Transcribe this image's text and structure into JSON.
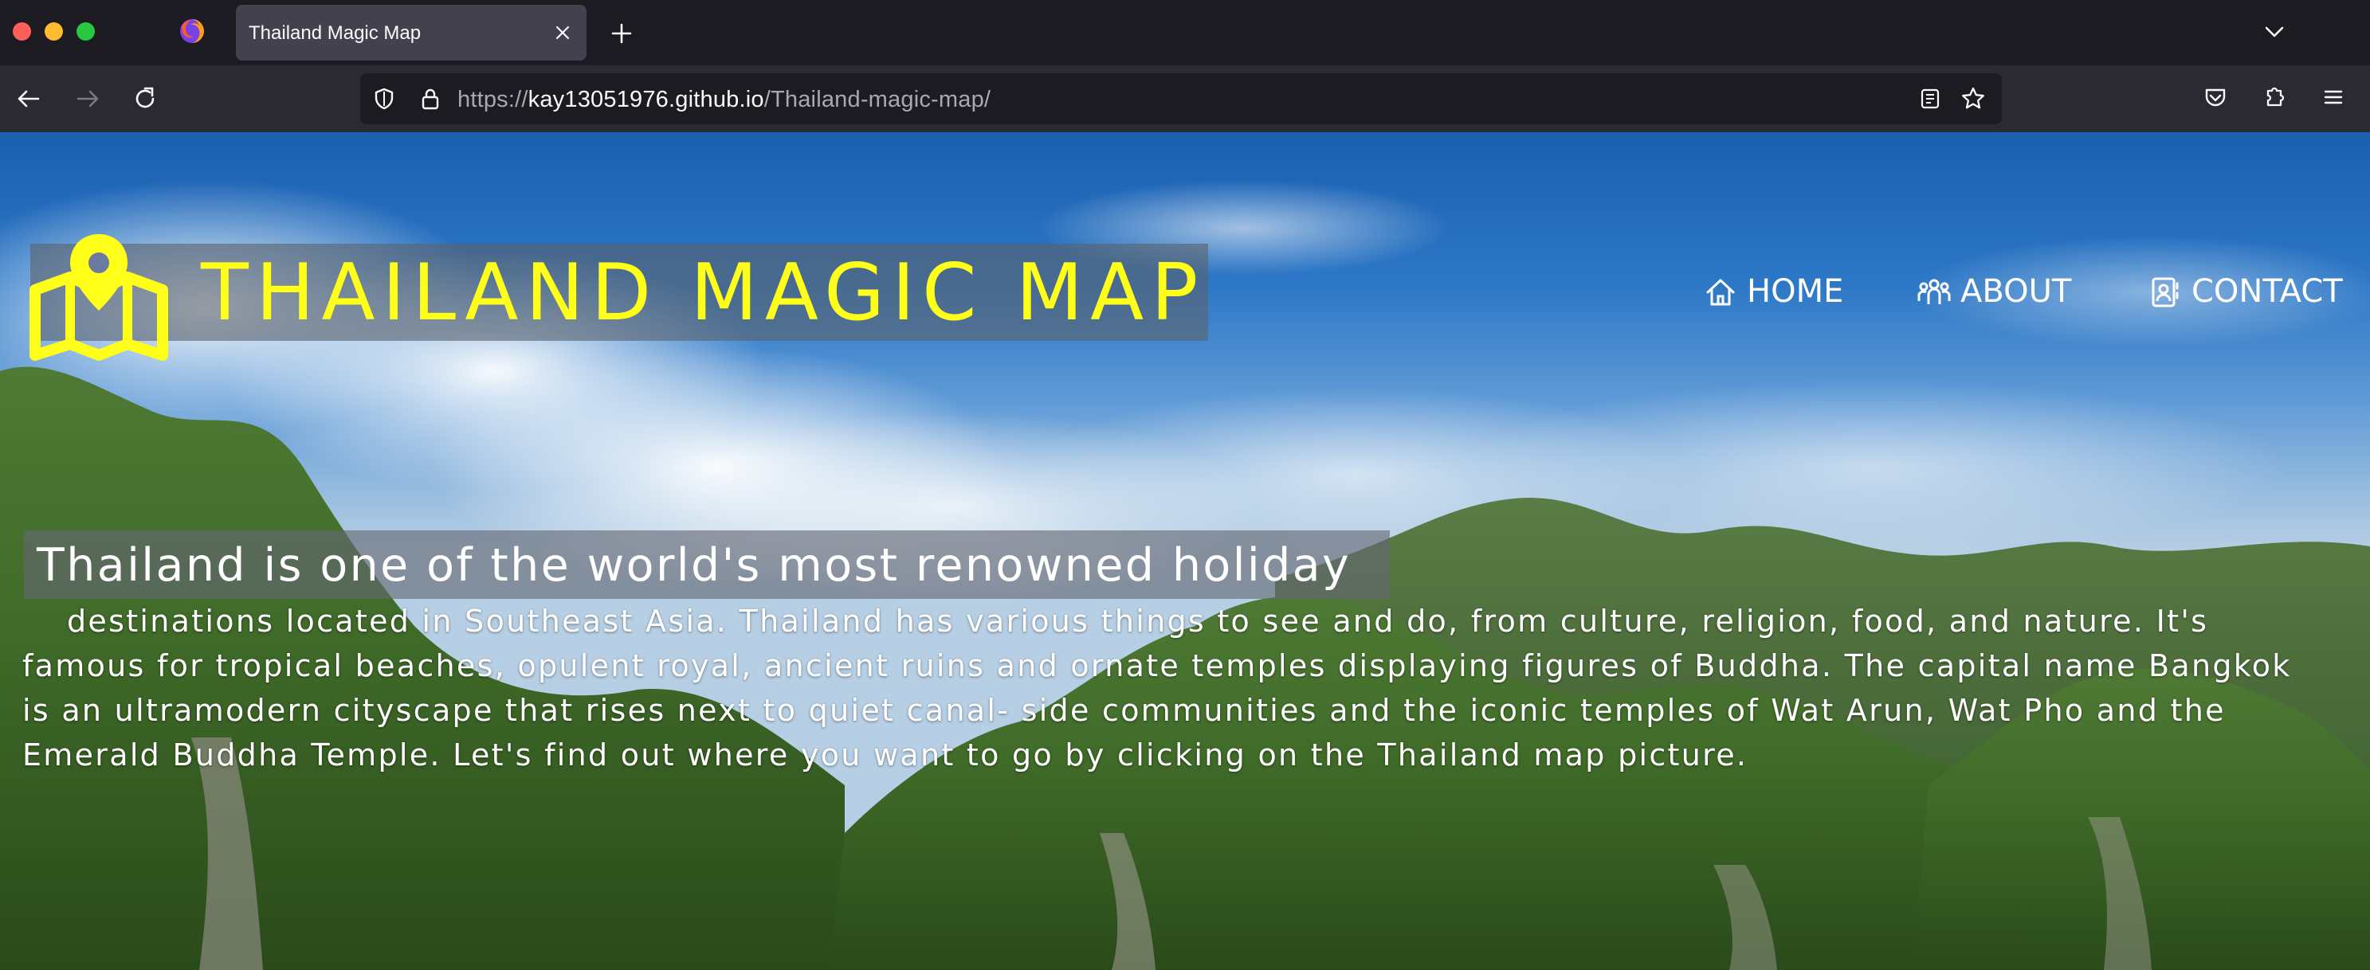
{
  "browser": {
    "tab": {
      "title": "Thailand Magic Map"
    },
    "url": {
      "scheme": "https://",
      "host": "kay13051976.github.io",
      "path": "/Thailand-magic-map/"
    }
  },
  "site": {
    "title": "THAILAND MAGIC MAP",
    "nav": [
      {
        "label": "HOME",
        "icon": "home-icon"
      },
      {
        "label": "ABOUT",
        "icon": "people-icon"
      },
      {
        "label": "CONTACT",
        "icon": "contact-card-icon"
      }
    ],
    "intro": {
      "lead": "Thailand is one of the world's most renowned holiday",
      "lines": [
        "destinations located in Southeast Asia. Thailand has various things to see and do, from culture, religion, food, and nature. It's",
        "famous for tropical beaches, opulent royal, ancient ruins and ornate temples displaying figures of Buddha. The capital name Bangkok",
        "is an ultramodern cityscape that rises next to quiet canal- side communities and the iconic temples of Wat Arun, Wat Pho and the",
        "Emerald Buddha Temple. Let's find out where you want to go by clicking on the Thailand map picture."
      ]
    }
  },
  "colors": {
    "title_yellow": "#ffff1a",
    "chrome_dark": "#1c1b22",
    "chrome_toolbar": "#2b2a33",
    "tab_active": "#42414d"
  }
}
